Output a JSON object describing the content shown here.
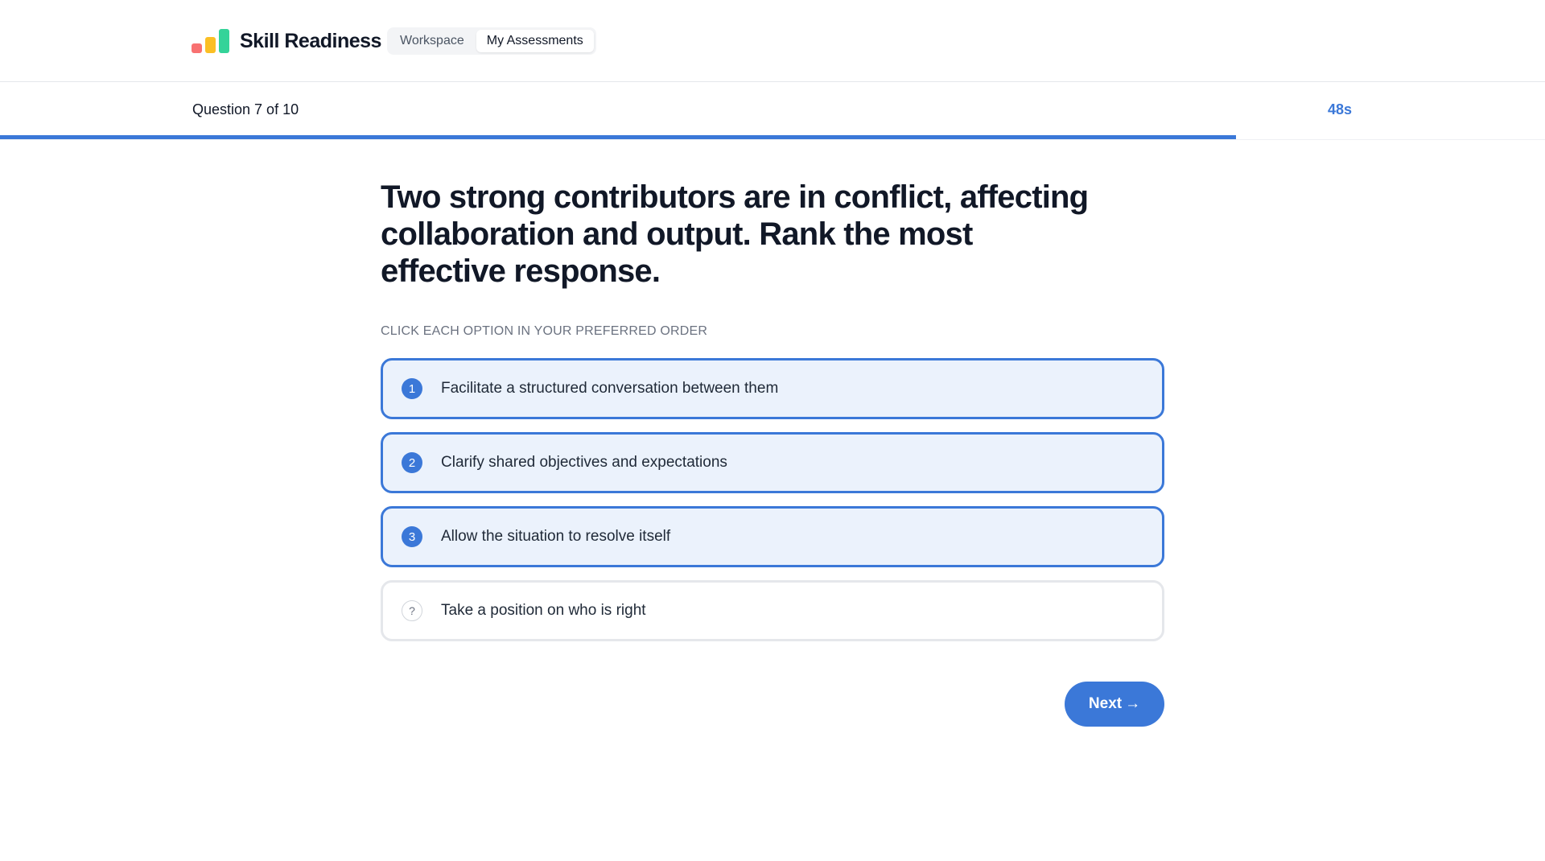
{
  "header": {
    "brand": "Skill Readiness",
    "tabs": [
      {
        "label": "Workspace",
        "active": false
      },
      {
        "label": "My Assessments",
        "active": true
      }
    ]
  },
  "progress": {
    "label": "Question 7 of 10",
    "current": 7,
    "total": 10,
    "fraction": 0.8,
    "timer": "48s"
  },
  "question": {
    "text": "Two strong contributors are in conflict, affecting collaboration and output. Rank the most effective response.",
    "instruction": "CLICK EACH OPTION IN YOUR PREFERRED ORDER",
    "options": [
      {
        "rank": "1",
        "label": "Facilitate a structured conversation between them",
        "selected": true
      },
      {
        "rank": "2",
        "label": "Clarify shared objectives and expectations",
        "selected": true
      },
      {
        "rank": "3",
        "label": "Allow the situation to resolve itself",
        "selected": true
      },
      {
        "rank": "?",
        "label": "Take a position on who is right",
        "selected": false
      }
    ]
  },
  "actions": {
    "next_label": "Next",
    "next_arrow": "→"
  },
  "colors": {
    "accent": "#3b78d8",
    "selected_bg": "#ebf2fc"
  }
}
